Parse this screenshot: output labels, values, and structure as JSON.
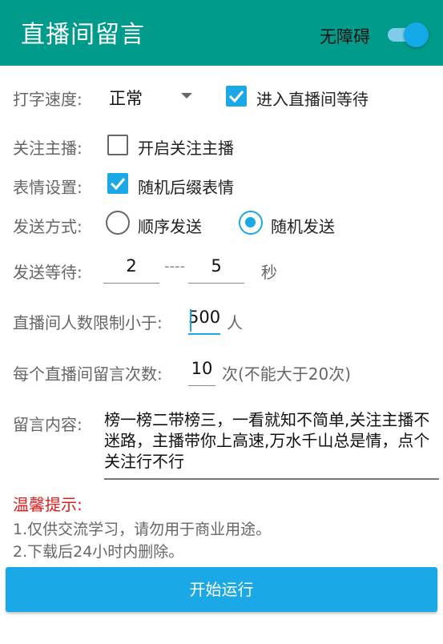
{
  "appbar": {
    "title": "直播间留言",
    "accessibility_label": "无障碍",
    "accessibility_enabled": true,
    "color": "#009b8a"
  },
  "typing_speed": {
    "label": "打字速度:",
    "value": "正常"
  },
  "enter_wait": {
    "label": "进入直播间等待",
    "checked": true
  },
  "follow": {
    "label": "关注主播:",
    "option_label": "开启关注主播",
    "checked": false
  },
  "emoji": {
    "label": "表情设置:",
    "option_label": "随机后缀表情",
    "checked": true
  },
  "send_mode": {
    "label": "发送方式:",
    "options": [
      "顺序发送",
      "随机发送"
    ],
    "selected": "随机发送"
  },
  "send_wait": {
    "label": "发送等待:",
    "min": "2",
    "separator": "----",
    "max": "5",
    "unit": "秒"
  },
  "room_limit": {
    "label": "直播间人数限制小于:",
    "value": "500",
    "unit": "人"
  },
  "comment_count": {
    "label": "每个直播间留言次数:",
    "value": "10",
    "unit": "次(不能大于20次)"
  },
  "content": {
    "label": "留言内容:",
    "value": "榜一榜二带榜三，一看就知不简单,关注主播不迷路，主播带你上高速,万水千山总是情，点个关注行不行"
  },
  "tips": {
    "title": "温馨提示:",
    "items": [
      "1.仅供交流学习，请勿用于商业用途。",
      "2.下载后24小时内删除。"
    ]
  },
  "start_button": {
    "label": "开始运行"
  },
  "colors": {
    "accent": "#1aa8e6",
    "warning": "#e21b1b"
  }
}
